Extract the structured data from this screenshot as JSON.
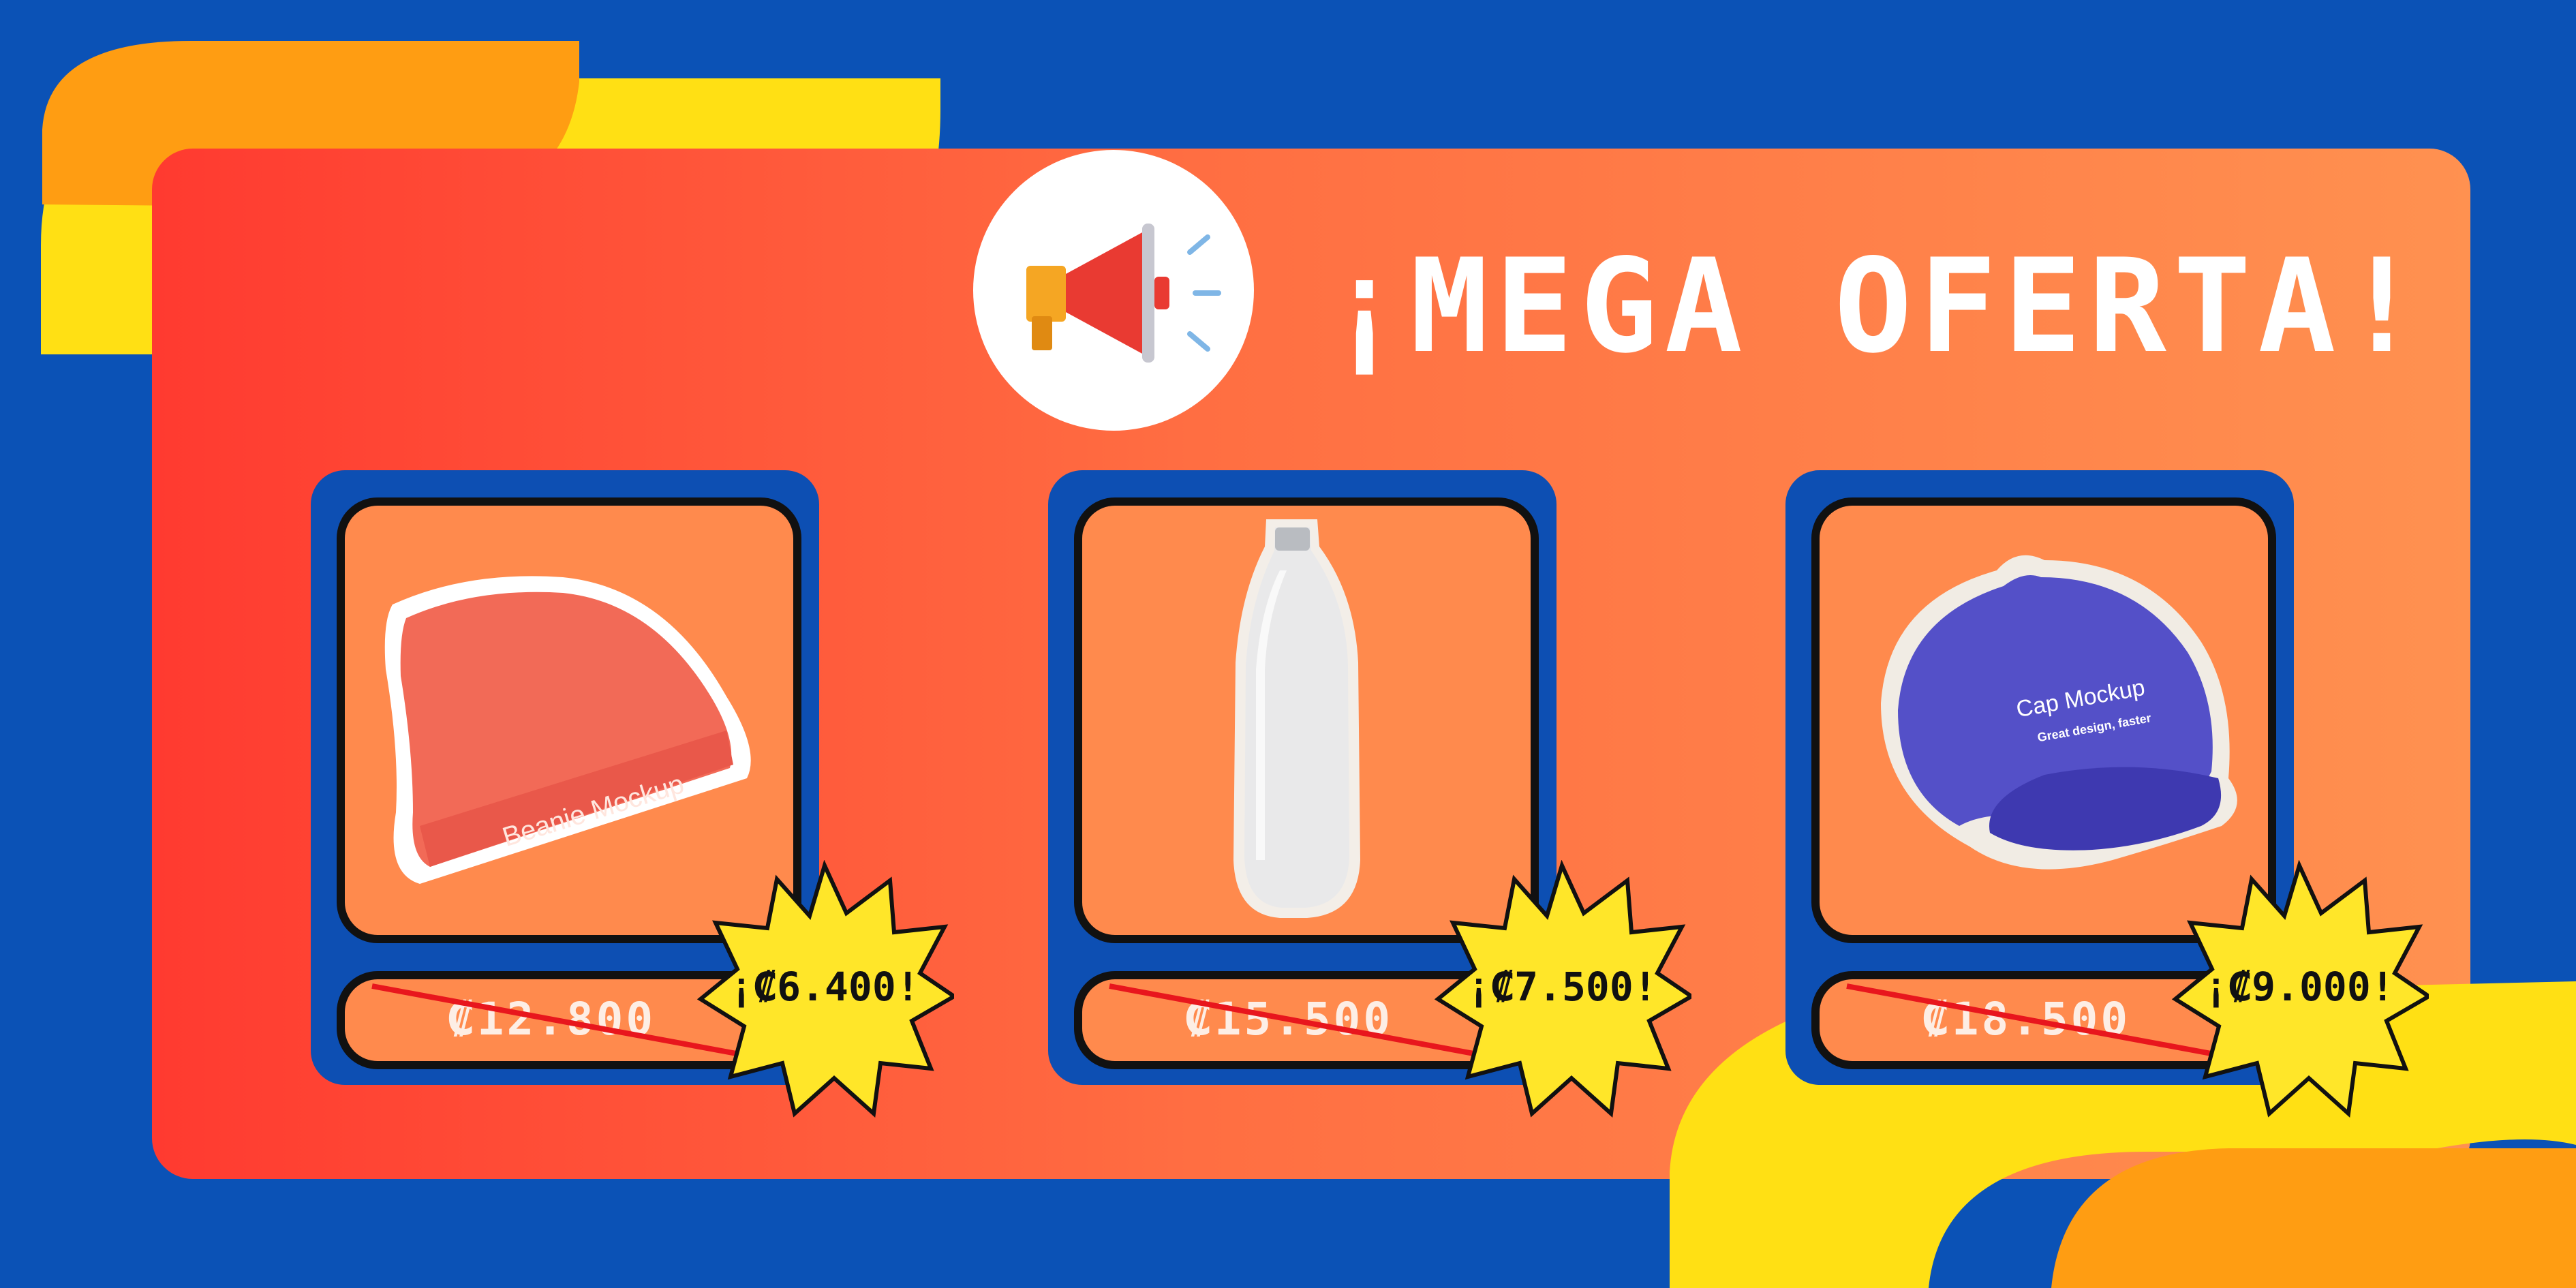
{
  "headline": "¡MEGA OFERTA!",
  "icons": {
    "megaphone": "megaphone-icon"
  },
  "colors": {
    "background": "#0b52b6",
    "panel_start": "#ff3a30",
    "panel_end": "#ff9150",
    "accent_yellow": "#ffe014",
    "accent_orange": "#ff9d12",
    "burst": "#ffe629"
  },
  "products": [
    {
      "name": "Beanie",
      "mockup_label": "Beanie Mockup",
      "old_price": "₡12.800",
      "new_price": "¡₡6.400!"
    },
    {
      "name": "Bottle",
      "old_price": "₡15.500",
      "new_price": "¡₡7.500!"
    },
    {
      "name": "Cap",
      "mockup_label": "Cap Mockup",
      "mockup_sublabel": "Great design, faster",
      "old_price": "₡18.500",
      "new_price": "¡₡9.000!"
    }
  ]
}
